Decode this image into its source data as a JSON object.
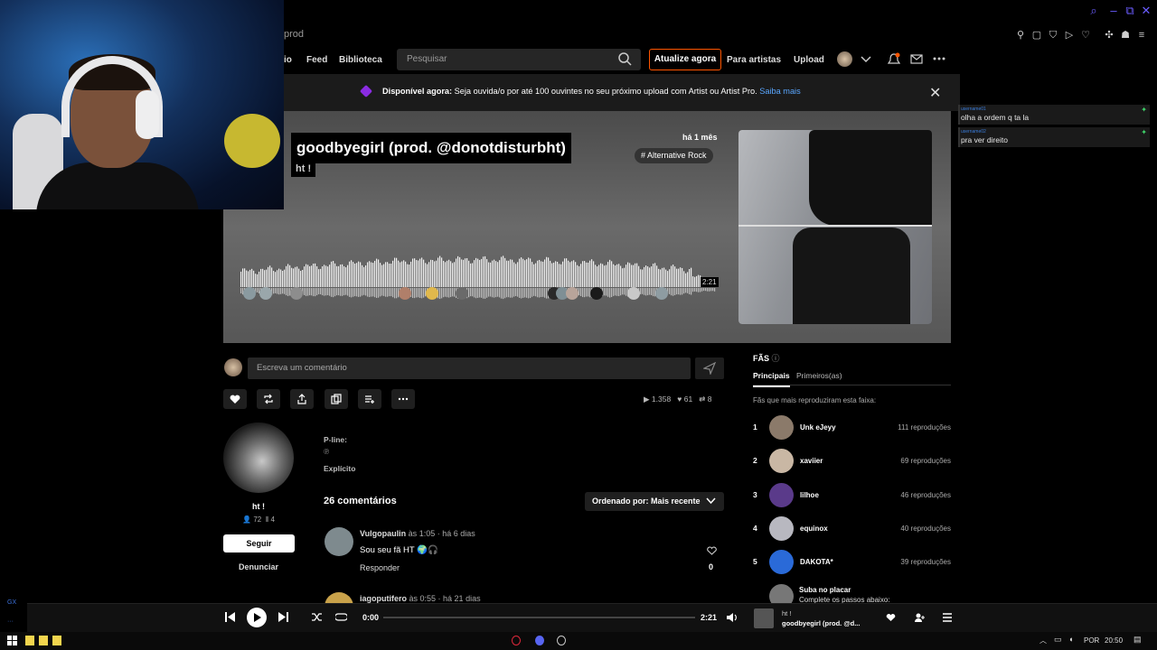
{
  "browser": {
    "tab_text": "prod"
  },
  "nav": {
    "partial_home": "io",
    "feed": "Feed",
    "library": "Biblioteca",
    "search_placeholder": "Pesquisar",
    "upgrade": "Atualize agora",
    "for_artists": "Para artistas",
    "upload": "Upload"
  },
  "banner": {
    "lead": "Disponível agora:",
    "text": " Seja ouvida/o por até 100 ouvintes no seu próximo upload com Artist ou Artist Pro. ",
    "link": "Saiba mais"
  },
  "track": {
    "title": "goodbyegirl (prod. @donotdisturbht)",
    "artist": "ht !",
    "posted": "há 1 mês",
    "genre": "# Alternative Rock",
    "duration": "2:21",
    "plays": "1.358",
    "likes": "61",
    "reposts": "8"
  },
  "comment_box": {
    "placeholder": "Escreva um comentário"
  },
  "artist": {
    "name": "ht !",
    "followers": "72",
    "following": "4",
    "follow_label": "Seguir",
    "report_label": "Denunciar"
  },
  "meta": {
    "pline_label": "P-line:",
    "pline_value": "℗",
    "explicit": "Explícito"
  },
  "comments": {
    "count_label": "26 comentários",
    "sort_label": "Ordenado por: Mais recente",
    "items": [
      {
        "user": "Vulgopaulin",
        "at": " às ",
        "time": "1:05",
        "ago": " · há 6 dias",
        "text": "Sou seu fã HT 🌍🎧",
        "reply": "Responder",
        "likes": "0"
      },
      {
        "user": "iagoputifero",
        "at": " às ",
        "time": "0:55",
        "ago": " · há 21 dias"
      }
    ]
  },
  "fans": {
    "title": "FÃS",
    "tab_main": "Principais",
    "tab_first": "Primeiros(as)",
    "subtitle": "Fãs que mais reproduziram esta faixa:",
    "list": [
      {
        "rank": "1",
        "name": "Unk eJeyy",
        "plays": "111 reproduções",
        "color": "#8b7a6a"
      },
      {
        "rank": "2",
        "name": "xaviier",
        "plays": "69 reproduções",
        "color": "#c9b7a4"
      },
      {
        "rank": "3",
        "name": "lilhoe",
        "plays": "46 reproduções",
        "color": "#5a3a8a"
      },
      {
        "rank": "4",
        "name": "equinox",
        "plays": "40 reproduções",
        "color": "#b8b8c0"
      },
      {
        "rank": "5",
        "name": "DAKOTA*",
        "plays": "39 reproduções",
        "color": "#2a6ad8"
      }
    ],
    "climb_title": "Suba no placar",
    "climb_sub": "Complete os passos abaixo:"
  },
  "chat": [
    {
      "user": "username01",
      "msg": "olha a ordem q ta la"
    },
    {
      "user": "username02",
      "msg": "pra ver direito"
    }
  ],
  "player": {
    "current": "0:00",
    "total": "2:21",
    "artist": "ht !",
    "title": "goodbyegirl (prod. @d..."
  },
  "taskbar": {
    "lang": "POR",
    "clock": "20:50"
  },
  "colors": {
    "accent": "#ff5500",
    "link": "#5aa7ff",
    "window_buttons": "#6a5cff"
  }
}
